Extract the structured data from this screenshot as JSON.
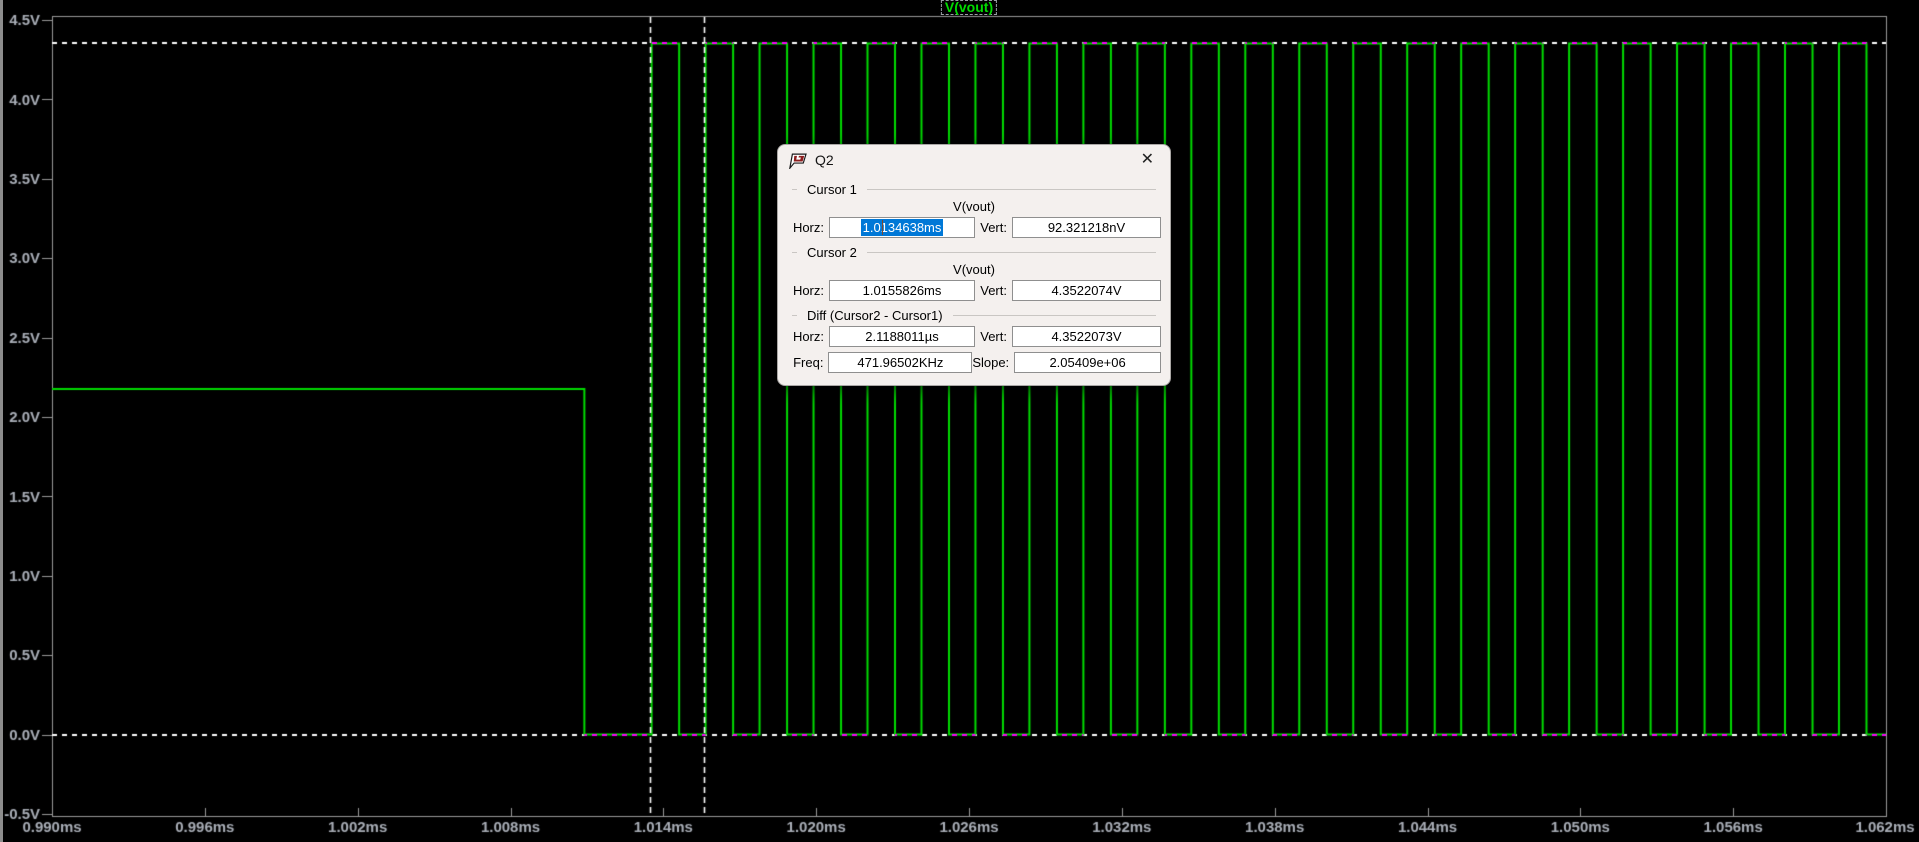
{
  "plot": {
    "title": "V(vout)",
    "colors": {
      "background": "#000000",
      "trace": "#00dc00",
      "axis_text": "#a9aeb7",
      "border": "#9a9a9a",
      "cursor_dash": "#ffffff",
      "cursor_xor_dash": "#ff00ff",
      "title_green": "#00dc00",
      "selection_blue": "#0078d7"
    }
  },
  "chart_data": {
    "type": "line",
    "title": "V(vout)",
    "xlabel": "",
    "ylabel": "",
    "grid": false,
    "legend_position": "top-center-title",
    "xlim_ms": [
      0.99,
      1.062
    ],
    "ylim_V": [
      -0.5,
      4.5
    ],
    "x_ticks": [
      "0.990ms",
      "0.996ms",
      "1.002ms",
      "1.008ms",
      "1.014ms",
      "1.020ms",
      "1.026ms",
      "1.032ms",
      "1.038ms",
      "1.044ms",
      "1.050ms",
      "1.056ms",
      "1.062ms"
    ],
    "x_tick_values_ms": [
      0.99,
      0.996,
      1.002,
      1.008,
      1.014,
      1.02,
      1.026,
      1.032,
      1.038,
      1.044,
      1.05,
      1.056,
      1.062
    ],
    "y_ticks": [
      "4.5V",
      "4.0V",
      "3.5V",
      "3.0V",
      "2.5V",
      "2.0V",
      "1.5V",
      "1.0V",
      "0.5V",
      "0.0V",
      "-0.5V"
    ],
    "y_tick_values_V": [
      4.5,
      4.0,
      3.5,
      3.0,
      2.5,
      2.0,
      1.5,
      1.0,
      0.5,
      0.0,
      -0.5
    ],
    "series": [
      {
        "name": "V(vout)",
        "color": "#00dc00",
        "description": "Flat at ~2.176V, falls to 0V at ~1.0109ms, then ~471.97kHz square wave between 0V and 4.3522V starting ~1.01354ms until right edge",
        "pre_level_V": 2.176,
        "drop_time_ms": 1.0109,
        "low_level_V": 0.0,
        "osc_start_ms": 1.01354,
        "period_us": 2.1188011,
        "duty_high": 0.51,
        "high_level_V": 4.3522074,
        "end_ms": 1.062
      }
    ],
    "cursors": {
      "cursor1": {
        "t_ms": 1.0134638,
        "v_level_V": 0.0,
        "v_label": "92.321218nV"
      },
      "cursor2": {
        "t_ms": 1.0155826,
        "v_level_V": 4.3522074,
        "v_label": "4.3522074V"
      }
    }
  },
  "dialog": {
    "title": "Q2",
    "close_label": "✕",
    "groups": {
      "cursor1": {
        "label": "Cursor 1",
        "trace": "V(vout)",
        "horz_label": "Horz:",
        "horz_value": "1.0134638ms",
        "vert_label": "Vert:",
        "vert_value": "92.321218nV"
      },
      "cursor2": {
        "label": "Cursor 2",
        "trace": "V(vout)",
        "horz_label": "Horz:",
        "horz_value": "1.0155826ms",
        "vert_label": "Vert:",
        "vert_value": "4.3522074V"
      },
      "diff": {
        "label": "Diff (Cursor2 - Cursor1)",
        "horz_label": "Horz:",
        "horz_value": "2.1188011µs",
        "vert_label": "Vert:",
        "vert_value": "4.3522073V",
        "freq_label": "Freq:",
        "freq_value": "471.96502KHz",
        "slope_label": "Slope:",
        "slope_value": "2.05409e+06"
      }
    }
  }
}
